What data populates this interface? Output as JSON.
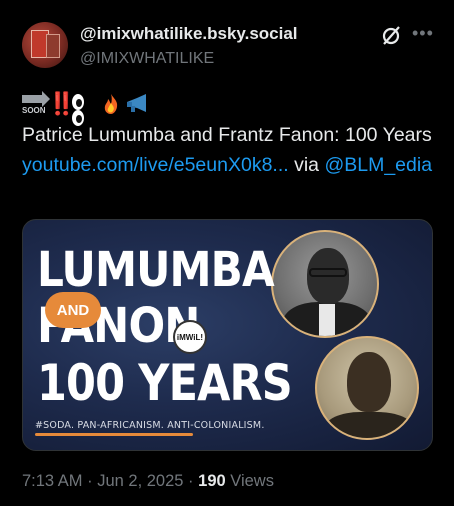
{
  "post": {
    "display_name": "@imixwhatilike.bsky.social",
    "handle": "@IMIXWHATILIKE",
    "emoji_soon_label": "SOON",
    "emoji_bang": "‼️",
    "text_before": "Patrice Lumumba and Frantz Fanon: 100 Years ",
    "link_text": "youtube.com/live/e5eunX0k8...",
    "text_mid": " via ",
    "mention": "@BLM_edia"
  },
  "card": {
    "line1": "LUMUMBA",
    "badge": "AND",
    "line2": "FANON",
    "line3": "100 YEARS",
    "logo_text": "iMWiL!",
    "tagline": "#SODA. PAN-AFRICANISM. ANTI-COLONIALISM."
  },
  "meta": {
    "time": "7:13 AM",
    "sep1": " · ",
    "date": "Jun 2, 2025",
    "sep2": " · ",
    "views_count": "190",
    "views_label": " Views"
  },
  "icons": {
    "more": "more-icon",
    "bluesky": "bluesky-icon"
  },
  "colors": {
    "link": "#1d9bf0",
    "muted": "#71767b",
    "accent_orange": "#e68a3a"
  }
}
